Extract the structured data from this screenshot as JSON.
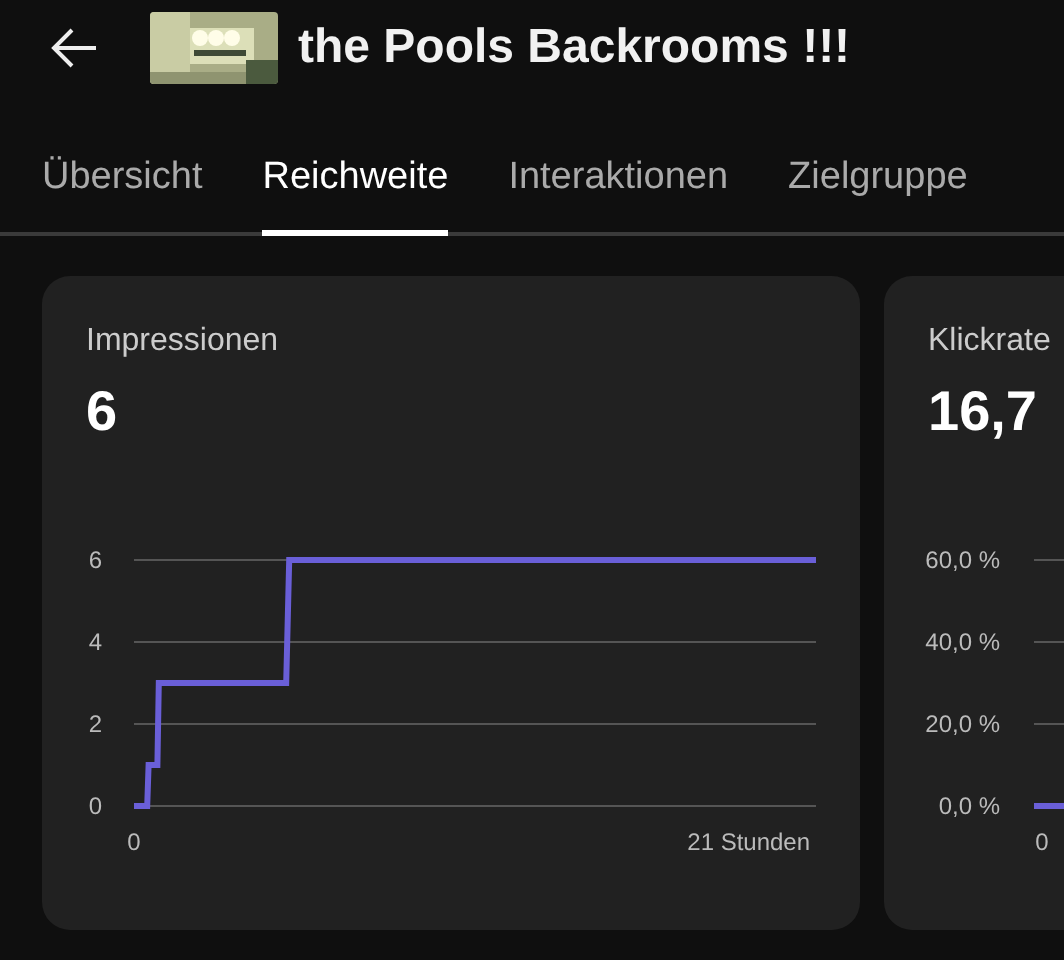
{
  "header": {
    "title": "the Pools Backrooms !!!"
  },
  "tabs": [
    {
      "label": "Übersicht",
      "selected": false
    },
    {
      "label": "Reichweite",
      "selected": true
    },
    {
      "label": "Interaktionen",
      "selected": false
    },
    {
      "label": "Zielgruppe",
      "selected": false
    }
  ],
  "cards": [
    {
      "title": "Impressionen",
      "value": "6",
      "chart_data": {
        "type": "line",
        "x": [
          0,
          0.45,
          0.5,
          0.8,
          0.85,
          5.2,
          5.3,
          23.3
        ],
        "xlim": [
          0,
          23.3
        ],
        "ylim": [
          0,
          6
        ],
        "yticks": [
          0,
          2,
          4,
          6
        ],
        "xticks": [
          0,
          {
            "value": 21,
            "label": "21 Stunden"
          }
        ],
        "series": [
          {
            "color": "#6a5fd8",
            "values": [
              0,
              0,
              1,
              1,
              3,
              3,
              6,
              6
            ]
          }
        ]
      }
    },
    {
      "title": "Klickrate",
      "value": "16,7",
      "axis": {
        "y_labels": [
          "60,0 %",
          "40,0 %",
          "20,0 %",
          "0,0 %"
        ],
        "x_labels": [
          "0"
        ]
      }
    }
  ]
}
